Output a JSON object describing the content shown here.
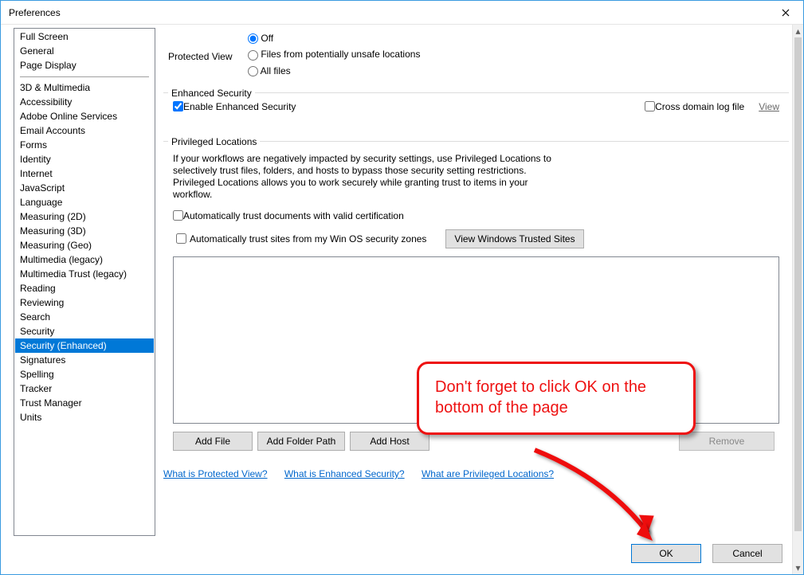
{
  "window": {
    "title": "Preferences"
  },
  "sidebar": {
    "top_items": [
      "Full Screen",
      "General",
      "Page Display"
    ],
    "items": [
      "3D & Multimedia",
      "Accessibility",
      "Adobe Online Services",
      "Email Accounts",
      "Forms",
      "Identity",
      "Internet",
      "JavaScript",
      "Language",
      "Measuring (2D)",
      "Measuring (3D)",
      "Measuring (Geo)",
      "Multimedia (legacy)",
      "Multimedia Trust (legacy)",
      "Reading",
      "Reviewing",
      "Search",
      "Security",
      "Security (Enhanced)",
      "Signatures",
      "Spelling",
      "Tracker",
      "Trust Manager",
      "Units"
    ],
    "selected": "Security (Enhanced)"
  },
  "panel": {
    "protected_view": {
      "label": "Protected View",
      "options": {
        "off": "Off",
        "unsafe": "Files from potentially unsafe locations",
        "all": "All files"
      },
      "selected": "off"
    },
    "enhanced_security": {
      "group_label": "Enhanced Security",
      "enable_label": "Enable Enhanced Security",
      "enable_checked": true,
      "cross_domain_label": "Cross domain log file",
      "cross_domain_checked": false,
      "view_link": "View"
    },
    "privileged": {
      "group_label": "Privileged Locations",
      "description": "If your workflows are negatively impacted by security settings, use Privileged Locations to selectively trust files, folders, and hosts to bypass those security setting restrictions. Privileged Locations allows you to work securely while granting trust to items in your workflow.",
      "auto_cert_label": "Automatically trust documents with valid certification",
      "auto_cert_checked": false,
      "auto_zones_label": "Automatically trust sites from my Win OS security zones",
      "auto_zones_checked": false,
      "view_trusted_btn": "View Windows Trusted Sites",
      "add_file_btn": "Add File",
      "add_folder_btn": "Add Folder Path",
      "add_host_btn": "Add Host",
      "remove_btn": "Remove"
    },
    "links": {
      "protected_view": "What is Protected View?",
      "enhanced_security": "What is Enhanced Security?",
      "privileged": "What are Privileged Locations?"
    }
  },
  "footer": {
    "ok": "OK",
    "cancel": "Cancel"
  },
  "callout": {
    "text": "Don't forget to click OK on the bottom of the page"
  }
}
